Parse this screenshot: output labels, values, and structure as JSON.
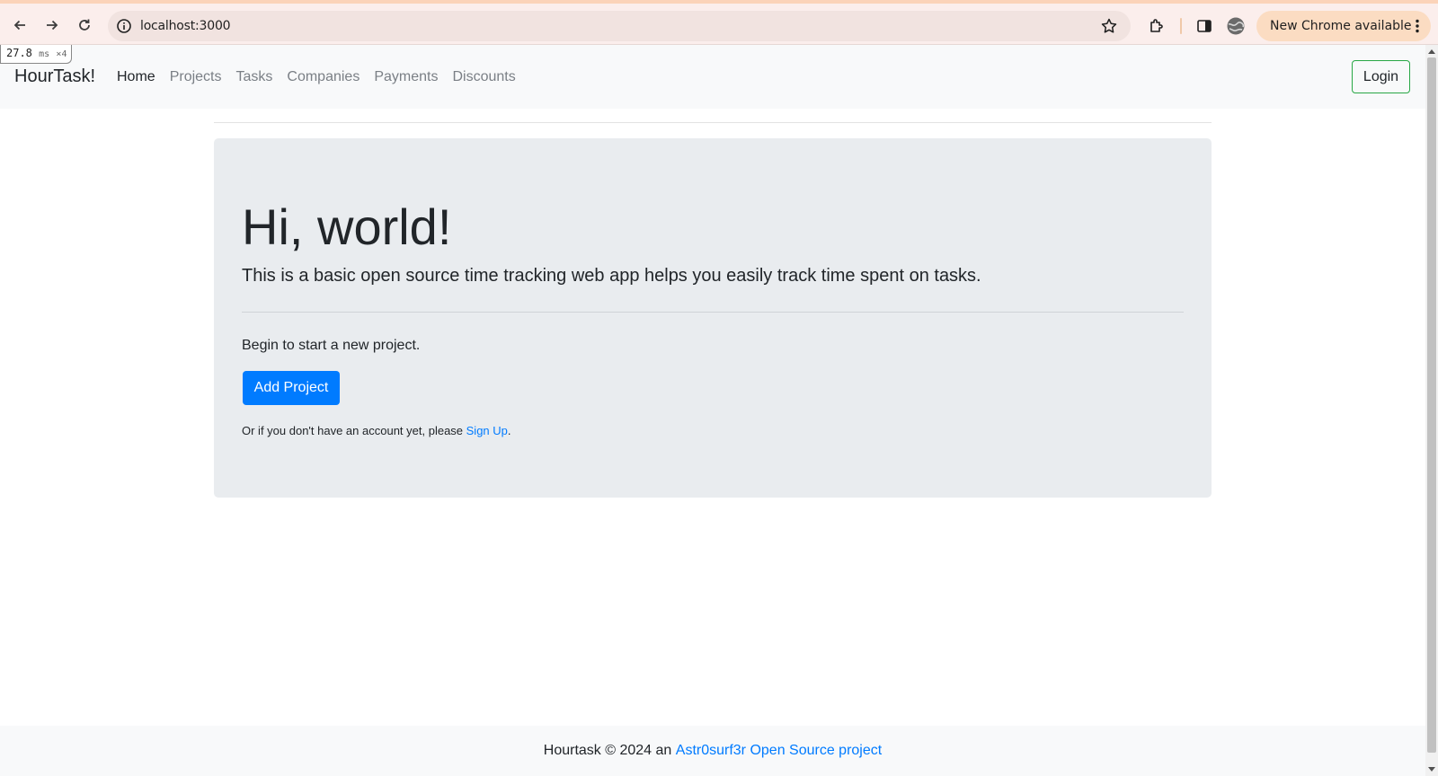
{
  "browser": {
    "url": "localhost:3000",
    "update_label": "New Chrome available",
    "perf_value": "27.8",
    "perf_unit": "ms",
    "perf_multiplier": "×4"
  },
  "navbar": {
    "brand": "HourTask!",
    "links": [
      {
        "label": "Home",
        "active": true
      },
      {
        "label": "Projects"
      },
      {
        "label": "Tasks"
      },
      {
        "label": "Companies"
      },
      {
        "label": "Payments"
      },
      {
        "label": "Discounts"
      }
    ],
    "login_label": "Login"
  },
  "hero": {
    "title": "Hi, world!",
    "lead": "This is a basic open source time tracking web app helps you easily track time spent on tasks.",
    "text": "Begin to start a new project.",
    "button_label": "Add Project",
    "signup_prefix": "Or if you don't have an account yet, please ",
    "signup_link": "Sign Up",
    "signup_suffix": "."
  },
  "footer": {
    "text": "Hourtask © 2024 an ",
    "link": "Astr0surf3r Open Source project"
  },
  "colors": {
    "primary": "#007bff",
    "success_outline": "#28a745",
    "jumbotron_bg": "#e9ecef",
    "navbar_bg": "#f8f9fa"
  }
}
